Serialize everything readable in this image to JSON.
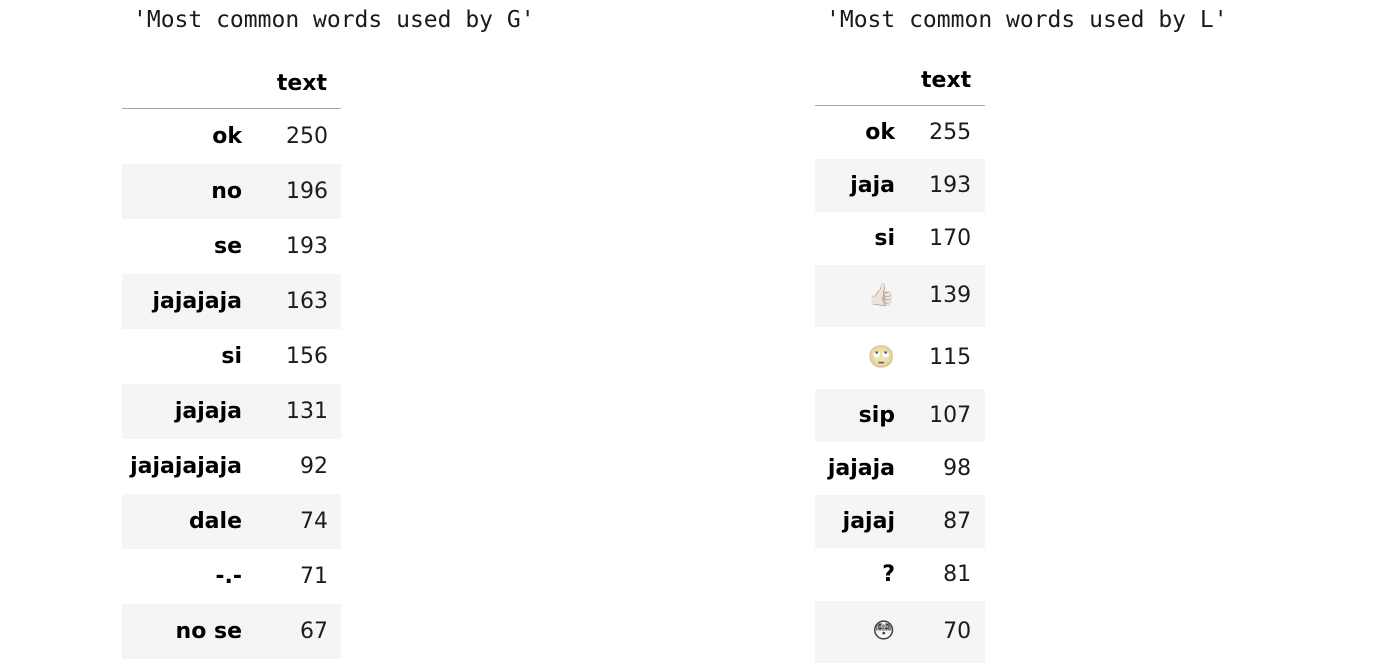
{
  "left": {
    "caption": "'Most common words used by G'",
    "column_header": "text",
    "rows": [
      {
        "word": "ok",
        "count": "250"
      },
      {
        "word": "no",
        "count": "196"
      },
      {
        "word": "se",
        "count": "193"
      },
      {
        "word": "jajajaja",
        "count": "163"
      },
      {
        "word": "si",
        "count": "156"
      },
      {
        "word": "jajaja",
        "count": "131"
      },
      {
        "word": "jajajajaja",
        "count": "92"
      },
      {
        "word": "dale",
        "count": "74"
      },
      {
        "word": "-.-",
        "count": "71"
      },
      {
        "word": "no se",
        "count": "67"
      }
    ]
  },
  "right": {
    "caption": "'Most common words used by L'",
    "column_header": "text",
    "rows": [
      {
        "word": "ok",
        "count": "255"
      },
      {
        "word": "jaja",
        "count": "193"
      },
      {
        "word": "si",
        "count": "170"
      },
      {
        "word": "👍🏻",
        "count": "139"
      },
      {
        "word": "🙄",
        "count": "115"
      },
      {
        "word": "sip",
        "count": "107"
      },
      {
        "word": "jajaja",
        "count": "98"
      },
      {
        "word": "jajaj",
        "count": "87"
      },
      {
        "word": "?",
        "count": "81"
      },
      {
        "word": "😳",
        "count": "70"
      }
    ]
  }
}
